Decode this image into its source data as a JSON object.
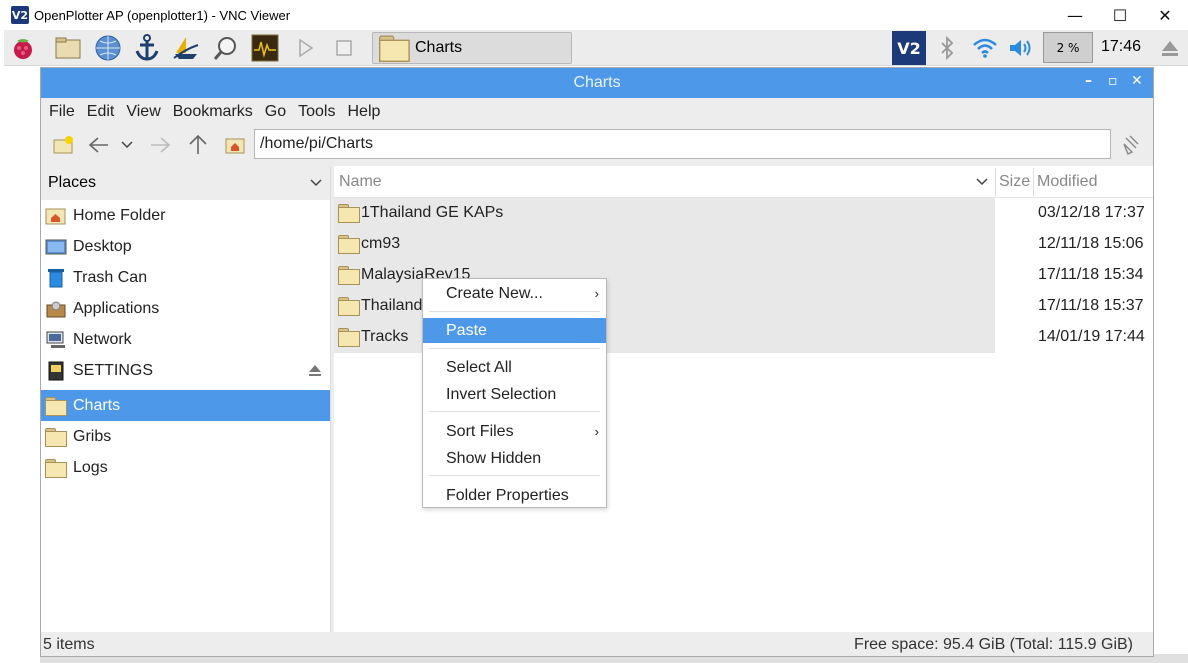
{
  "vnc": {
    "logo": "V2",
    "title": "OpenPlotter AP (openplotter1) - VNC Viewer",
    "minimize": "—",
    "maximize": "☐",
    "close": "✕"
  },
  "taskbar": {
    "task_button_label": "Charts",
    "cpu": "2 %",
    "clock": "17:46",
    "icons": [
      "raspberry-menu-icon",
      "file-manager-icon",
      "browser-globe-icon",
      "anchor-icon",
      "openplotter-boat-icon",
      "magnifier-icon",
      "cpu-monitor-icon",
      "play-icon",
      "stop-icon",
      "vnc-icon",
      "bluetooth-icon",
      "wifi-icon",
      "volume-icon",
      "eject-icon"
    ]
  },
  "window": {
    "title": "Charts",
    "minimize": "–",
    "maximize": "▫",
    "close": "✕"
  },
  "menubar": [
    "File",
    "Edit",
    "View",
    "Bookmarks",
    "Go",
    "Tools",
    "Help"
  ],
  "toolbar": {
    "path": "/home/pi/Charts"
  },
  "places": {
    "header": "Places",
    "items": [
      {
        "label": "Home Folder",
        "icon": "home-folder-icon"
      },
      {
        "label": "Desktop",
        "icon": "desktop-icon"
      },
      {
        "label": "Trash Can",
        "icon": "trash-icon"
      },
      {
        "label": "Applications",
        "icon": "applications-icon"
      },
      {
        "label": "Network",
        "icon": "network-icon"
      },
      {
        "label": "SETTINGS",
        "icon": "drive-icon"
      }
    ],
    "bookmarks": [
      {
        "label": "Charts",
        "active": true
      },
      {
        "label": "Gribs",
        "active": false
      },
      {
        "label": "Logs",
        "active": false
      }
    ]
  },
  "columns": {
    "name": "Name",
    "size": "Size",
    "modified": "Modified"
  },
  "files": [
    {
      "name": "1Thailand GE KAPs",
      "modified": "03/12/18 17:37"
    },
    {
      "name": "cm93",
      "modified": "12/11/18 15:06"
    },
    {
      "name": "MalaysiaRev15",
      "modified": "17/11/18 15:34"
    },
    {
      "name": "Thailand",
      "modified": "17/11/18 15:37"
    },
    {
      "name": "Tracks",
      "modified": "14/01/19 17:44"
    }
  ],
  "status": {
    "count": "5 items",
    "free": "Free space: 95.4 GiB (Total: 115.9 GiB)"
  },
  "context_menu": {
    "create_new": "Create New...",
    "paste": "Paste",
    "select_all": "Select All",
    "invert_selection": "Invert Selection",
    "sort_files": "Sort Files",
    "show_hidden": "Show Hidden",
    "folder_properties": "Folder Properties"
  },
  "colors": {
    "accent": "#4d98e8",
    "titlebar_text": "#eaf3ff"
  }
}
